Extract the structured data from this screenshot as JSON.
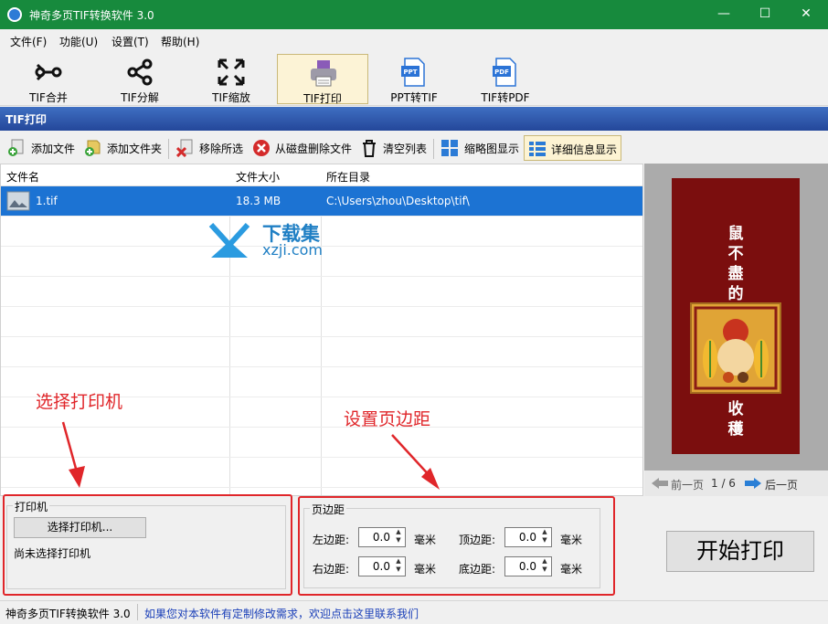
{
  "window": {
    "title": "神奇多页TIF转换软件 3.0"
  },
  "menu": [
    "文件(F)",
    "功能(U)",
    "设置(T)",
    "帮助(H)"
  ],
  "toolbar": [
    {
      "label": "TIF合并",
      "icon": "merge-icon"
    },
    {
      "label": "TIF分解",
      "icon": "split-icon"
    },
    {
      "label": "TIF缩放",
      "icon": "resize-icon"
    },
    {
      "label": "TIF打印",
      "icon": "printer-icon",
      "active": true
    },
    {
      "label": "PPT转TIF",
      "icon": "ppt-file-icon"
    },
    {
      "label": "TIF转PDF",
      "icon": "pdf-file-icon"
    }
  ],
  "section": {
    "title": "TIF打印"
  },
  "subtoolbar": {
    "add_file": "添加文件",
    "add_folder": "添加文件夹",
    "remove_selected": "移除所选",
    "delete_from_disk": "从磁盘删除文件",
    "clear_list": "清空列表",
    "thumbnail_view": "缩略图显示",
    "detail_view": "详细信息显示"
  },
  "table": {
    "headers": [
      "文件名",
      "文件大小",
      "所在目录"
    ],
    "rows": [
      {
        "name": "1.tif",
        "size": "18.3 MB",
        "dir": "C:\\Users\\zhou\\Desktop\\tif\\"
      }
    ]
  },
  "watermark": {
    "title": "下载集",
    "site": "xzji.com"
  },
  "preview": {
    "top_text": "鼠不盡的",
    "bottom_text": "收穫",
    "prev_label": "前一页",
    "page": "1 / 6",
    "next_label": "后一页"
  },
  "printer": {
    "group_label": "打印机",
    "select_button": "选择打印机...",
    "status": "尚未选择打印机"
  },
  "margins": {
    "group_label": "页边距",
    "left_label": "左边距:",
    "left_value": "0.0",
    "top_label": "顶边距:",
    "top_value": "0.0",
    "right_label": "右边距:",
    "right_value": "0.0",
    "bottom_label": "底边距:",
    "bottom_value": "0.0",
    "unit": "毫米"
  },
  "start_button": "开始打印",
  "annotations": {
    "printer": "选择打印机",
    "margins": "设置页边距"
  },
  "status": {
    "app": "神奇多页TIF转换软件 3.0",
    "link": "如果您对本软件有定制修改需求，欢迎点击这里联系我们"
  },
  "colors": {
    "titlebar": "#178a3d",
    "selection": "#1c73d3",
    "annotation": "#e0262a",
    "header": "#2d58aa"
  }
}
